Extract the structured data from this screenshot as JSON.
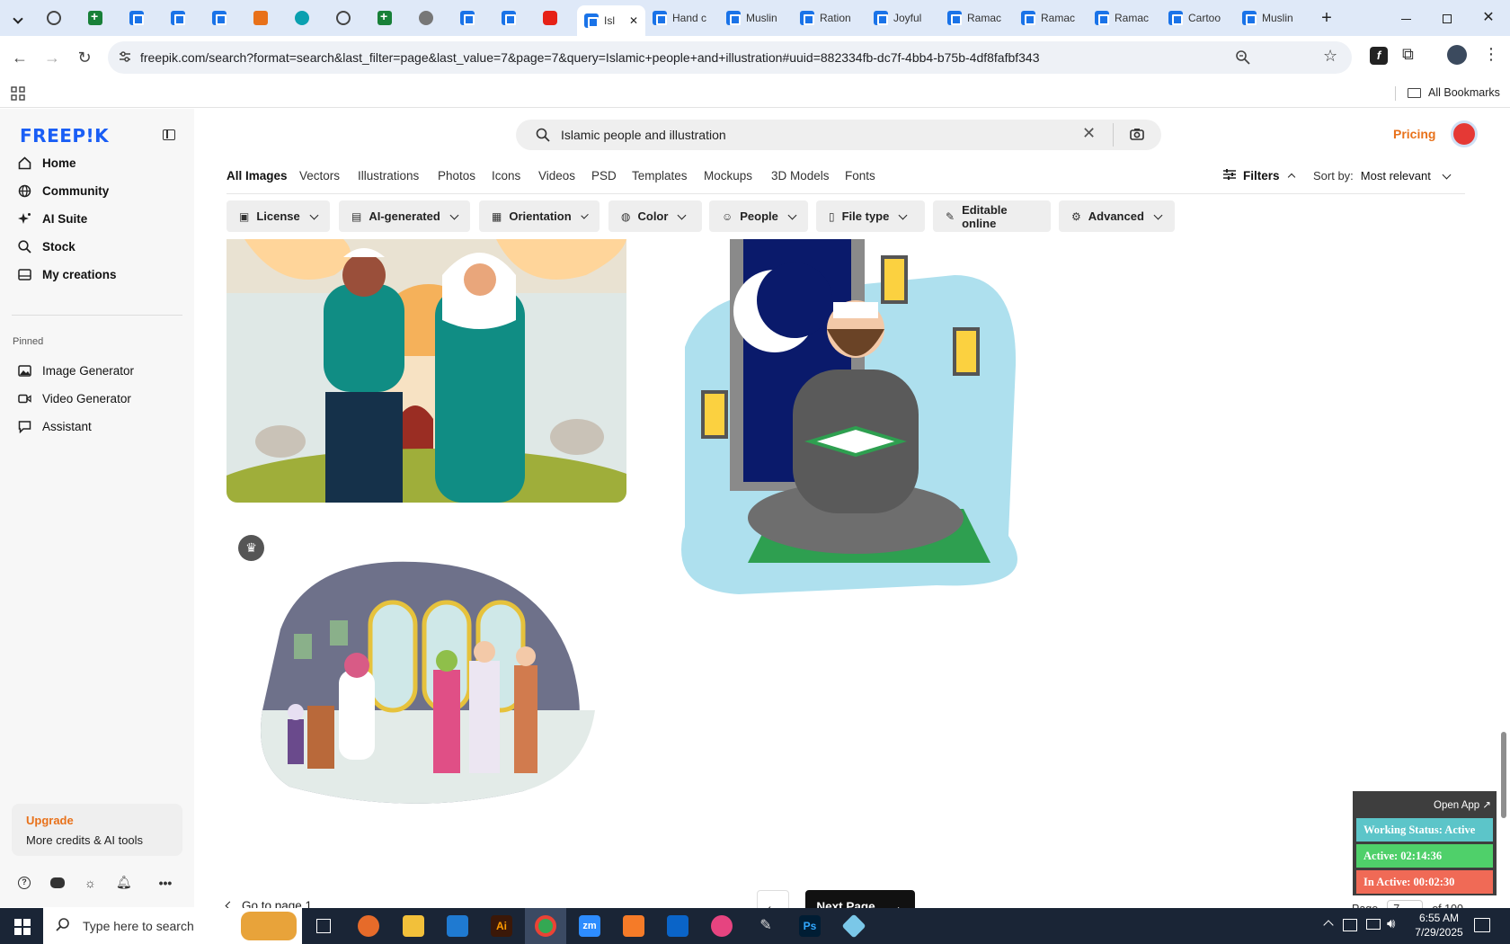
{
  "browser": {
    "tabs": [
      {
        "label": "",
        "icon": "wordpress-icon"
      },
      {
        "label": "",
        "icon": "sheets-icon"
      },
      {
        "label": "",
        "icon": "docs-icon"
      },
      {
        "label": "",
        "icon": "docs-icon"
      },
      {
        "label": "",
        "icon": "docs-icon"
      },
      {
        "label": "",
        "icon": "orange-app-icon"
      },
      {
        "label": "",
        "icon": "teal-app-icon"
      },
      {
        "label": "",
        "icon": "openai-icon"
      },
      {
        "label": "",
        "icon": "sheets-icon"
      },
      {
        "label": "",
        "icon": "globe-icon"
      },
      {
        "label": "",
        "icon": "qr-icon"
      },
      {
        "label": "",
        "icon": "docs-icon"
      },
      {
        "label": "",
        "icon": "youtube-icon"
      },
      {
        "label": "Isl",
        "icon": "docs-icon",
        "active": true
      },
      {
        "label": "Hand c",
        "icon": "docs-icon"
      },
      {
        "label": "Muslin",
        "icon": "docs-icon"
      },
      {
        "label": "Ration",
        "icon": "docs-icon"
      },
      {
        "label": "Joyful",
        "icon": "docs-icon"
      },
      {
        "label": "Ramac",
        "icon": "docs-icon"
      },
      {
        "label": "Ramac",
        "icon": "docs-icon"
      },
      {
        "label": "Ramac",
        "icon": "docs-icon"
      },
      {
        "label": "Cartoo",
        "icon": "docs-icon"
      },
      {
        "label": "Muslin",
        "icon": "docs-icon"
      }
    ],
    "url": "freepik.com/search?format=search&last_filter=page&last_value=7&page=7&query=Islamic+people+and+illustration#uuid=882334fb-dc7f-4bb4-b75b-4df8fafbf343",
    "bookmarks_label": "All Bookmarks"
  },
  "sidebar": {
    "logo": "FREEP!K",
    "nav": [
      {
        "label": "Home",
        "icon": "home-icon"
      },
      {
        "label": "Community",
        "icon": "globe-icon"
      },
      {
        "label": "AI Suite",
        "icon": "sparkle-icon"
      },
      {
        "label": "Stock",
        "icon": "search-icon"
      },
      {
        "label": "My creations",
        "icon": "folder-icon"
      }
    ],
    "pinned_label": "Pinned",
    "pinned": [
      {
        "label": "Image Generator",
        "icon": "image-icon"
      },
      {
        "label": "Video Generator",
        "icon": "video-icon"
      },
      {
        "label": "Assistant",
        "icon": "chat-icon"
      }
    ],
    "upgrade_title": "Upgrade",
    "upgrade_sub": "More credits & AI tools"
  },
  "header": {
    "search_value": "Islamic people and illustration",
    "pricing": "Pricing"
  },
  "categories": [
    "All Images",
    "Vectors",
    "Illustrations",
    "Photos",
    "Icons",
    "Videos",
    "PSD",
    "Templates",
    "Mockups",
    "3D Models",
    "Fonts"
  ],
  "filters_label": "Filters",
  "sort": {
    "label": "Sort by:",
    "value": "Most relevant"
  },
  "filter_pills": [
    "License",
    "AI-generated",
    "Orientation",
    "Color",
    "People",
    "File type",
    "Editable online",
    "Advanced"
  ],
  "pagination": {
    "go_to_first": "Go to page 1",
    "next": "Next Page",
    "page_label": "Page",
    "page_value": "7",
    "of_label": "of 100"
  },
  "tracker": {
    "open_app": "Open App ↗",
    "status": "Working Status: Active",
    "active": "Active: 02:14:36",
    "inactive": "In Active: 00:02:30"
  },
  "taskbar": {
    "search_placeholder": "Type here to search",
    "time": "6:55 AM",
    "date": "7/29/2025"
  },
  "colors": {
    "brand_blue": "#1a5ef5",
    "pricing_orange": "#e8711a",
    "upgrade_orange": "#e8711a",
    "tracker_status": "#5cc5c9",
    "tracker_active": "#4fd06a",
    "tracker_inactive": "#f06a56"
  }
}
